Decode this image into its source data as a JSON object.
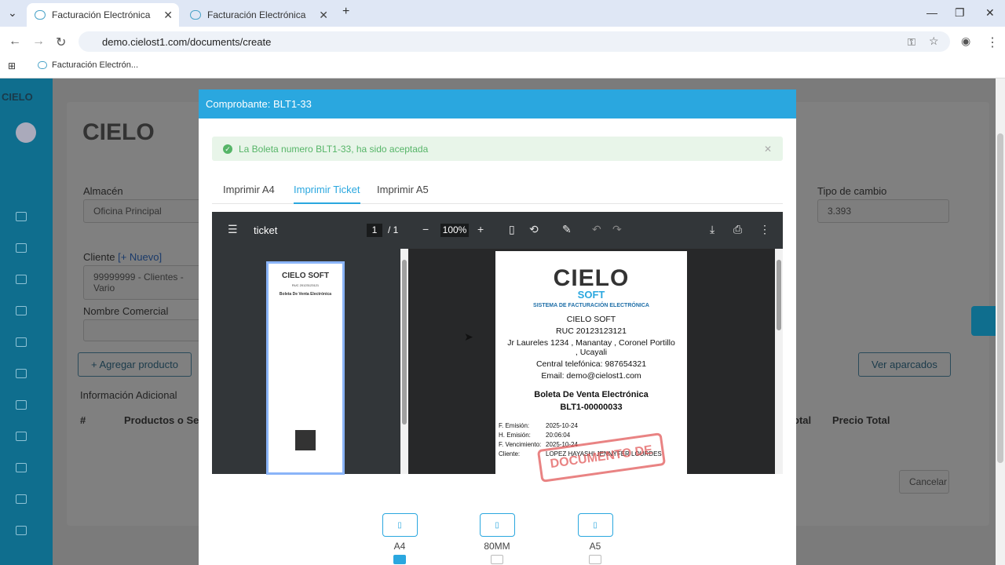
{
  "browser": {
    "tabs": [
      {
        "title": "Facturación Electrónica"
      },
      {
        "title": "Facturación Electrónica"
      }
    ],
    "url": "demo.cielost1.com/documents/create",
    "bookmark": "Facturación Electrón..."
  },
  "background": {
    "logo_text": "CIELO",
    "logo_sub": "SOFT",
    "logo_tag": "SISTEMA DE FACTURACIÓN ELECTRÓNICA",
    "almacen_label": "Almacén",
    "almacen_value": "Oficina Principal",
    "tipo_cambio_label": "Tipo de cambio",
    "tipo_cambio_value": "3.393",
    "cliente_label": "Cliente",
    "cliente_nuevo": "[+ Nuevo]",
    "cliente_value": "99999999 - Clientes - Vario",
    "nombre_comercial_label": "Nombre Comercial",
    "agregar_producto": "+ Agregar producto",
    "ver_aparcados": "Ver aparcados",
    "info_adicional": "Información Adicional",
    "col_hash": "#",
    "col_productos": "Productos o Servi",
    "col_total": "otal",
    "col_precio_total": "Precio Total",
    "cancelar": "Cancelar"
  },
  "modal": {
    "title": "Comprobante: BLT1-33",
    "alert": "La Boleta numero BLT1-33, ha sido aceptada",
    "tabs": [
      "Imprimir A4",
      "Imprimir Ticket",
      "Imprimir A5"
    ],
    "pdf": {
      "title": "ticket",
      "page": "1",
      "pages": "/ 1",
      "zoom": "100%"
    },
    "ticket": {
      "company": "CIELO SOFT",
      "ruc": "RUC 20123123121",
      "address": "Jr Laureles 1234 , Manantay , Coronel Portillo , Ucayali",
      "phone": "Central telefónica: 987654321",
      "email": "Email: demo@cielost1.com",
      "doc_type": "Boleta De Venta Electrónica",
      "doc_number": "BLT1-00000033",
      "rows": [
        {
          "k": "F. Emisión:",
          "v": "2025-10-24"
        },
        {
          "k": "H. Emisión:",
          "v": "20:06:04"
        },
        {
          "k": "F. Vencimiento:",
          "v": "2025-10-24"
        },
        {
          "k": "Cliente:",
          "v": "LOPEZ HAYASHI JENNYFER LOURDES"
        }
      ],
      "stamp": "DOCUMENTO DE"
    },
    "formats": [
      {
        "label": "A4",
        "checked": true
      },
      {
        "label": "80MM",
        "checked": false
      },
      {
        "label": "A5",
        "checked": false
      }
    ]
  }
}
